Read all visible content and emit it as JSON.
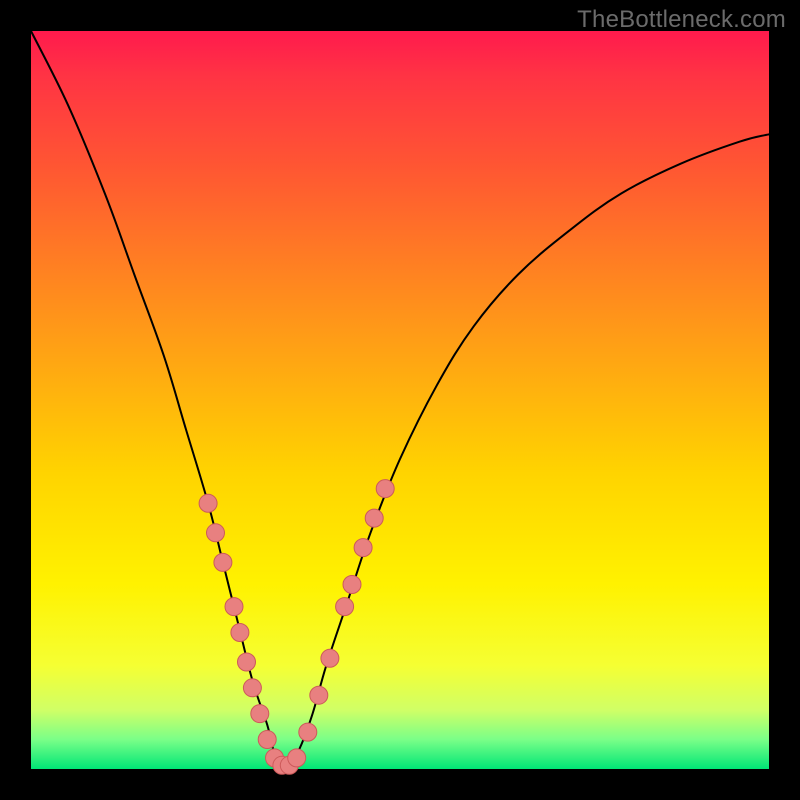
{
  "watermark": "TheBottleneck.com",
  "colors": {
    "background": "#000000",
    "gradient_top": "#ff1a4d",
    "gradient_bottom": "#00e676",
    "curve": "#000000",
    "dot_fill": "#e88080",
    "dot_stroke": "#cc5a5a"
  },
  "chart_data": {
    "type": "line",
    "title": "",
    "xlabel": "",
    "ylabel": "",
    "xlim": [
      0,
      100
    ],
    "ylim": [
      0,
      100
    ],
    "grid": false,
    "legend": false,
    "series": [
      {
        "name": "bottleneck-curve",
        "x": [
          0,
          5,
          10,
          14,
          18,
          21,
          24,
          26,
          28,
          30,
          32,
          33,
          34,
          36,
          38,
          40,
          43,
          46,
          50,
          55,
          60,
          66,
          73,
          80,
          88,
          96,
          100
        ],
        "y": [
          100,
          90,
          78,
          67,
          56,
          46,
          36,
          28,
          20,
          12,
          6,
          2,
          0,
          2,
          7,
          14,
          23,
          32,
          42,
          52,
          60,
          67,
          73,
          78,
          82,
          85,
          86
        ]
      }
    ],
    "markers": [
      {
        "name": "highlighted-points",
        "points": [
          {
            "x": 24.0,
            "y": 36.0
          },
          {
            "x": 25.0,
            "y": 32.0
          },
          {
            "x": 26.0,
            "y": 28.0
          },
          {
            "x": 27.5,
            "y": 22.0
          },
          {
            "x": 28.3,
            "y": 18.5
          },
          {
            "x": 29.2,
            "y": 14.5
          },
          {
            "x": 30.0,
            "y": 11.0
          },
          {
            "x": 31.0,
            "y": 7.5
          },
          {
            "x": 32.0,
            "y": 4.0
          },
          {
            "x": 33.0,
            "y": 1.5
          },
          {
            "x": 34.0,
            "y": 0.5
          },
          {
            "x": 35.0,
            "y": 0.5
          },
          {
            "x": 36.0,
            "y": 1.5
          },
          {
            "x": 37.5,
            "y": 5.0
          },
          {
            "x": 39.0,
            "y": 10.0
          },
          {
            "x": 40.5,
            "y": 15.0
          },
          {
            "x": 42.5,
            "y": 22.0
          },
          {
            "x": 43.5,
            "y": 25.0
          },
          {
            "x": 45.0,
            "y": 30.0
          },
          {
            "x": 46.5,
            "y": 34.0
          },
          {
            "x": 48.0,
            "y": 38.0
          }
        ]
      }
    ],
    "annotations": [
      {
        "text": "TheBottleneck.com",
        "position": "top-right"
      }
    ]
  }
}
